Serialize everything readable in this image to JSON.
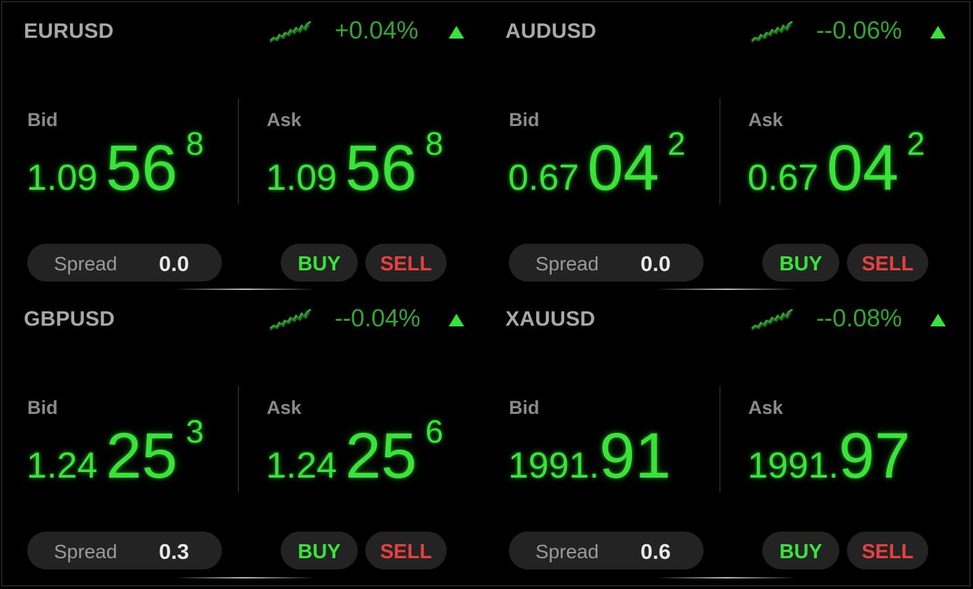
{
  "colors": {
    "background": "#000000",
    "price_green": "#37e437",
    "change_green": "#2ea82e",
    "sell_red": "#e84040",
    "label_gray": "#8a8a8a",
    "pill_bg": "#232323"
  },
  "panels": [
    {
      "symbol": "EURUSD",
      "change": "+0.04%",
      "trend_icon": "sparkline-icon",
      "direction_icon": "triangle-up-icon",
      "bid_label": "Bid",
      "ask_label": "Ask",
      "bid": {
        "prefix": "1.09",
        "big": "56",
        "pip": "8"
      },
      "ask": {
        "prefix": "1.09",
        "big": "56",
        "pip": "8"
      },
      "spread_label": "Spread",
      "spread_value": "0.0",
      "buy_label": "BUY",
      "sell_label": "SELL"
    },
    {
      "symbol": "AUDUSD",
      "change": "--0.06%",
      "trend_icon": "sparkline-icon",
      "direction_icon": "triangle-up-icon",
      "bid_label": "Bid",
      "ask_label": "Ask",
      "bid": {
        "prefix": "0.67",
        "big": "04",
        "pip": "2"
      },
      "ask": {
        "prefix": "0.67",
        "big": "04",
        "pip": "2"
      },
      "spread_label": "Spread",
      "spread_value": "0.0",
      "buy_label": "BUY",
      "sell_label": "SELL"
    },
    {
      "symbol": "GBPUSD",
      "change": "--0.04%",
      "trend_icon": "sparkline-icon",
      "direction_icon": "triangle-up-icon",
      "bid_label": "Bid",
      "ask_label": "Ask",
      "bid": {
        "prefix": "1.24",
        "big": "25",
        "pip": "3"
      },
      "ask": {
        "prefix": "1.24",
        "big": "25",
        "pip": "6"
      },
      "spread_label": "Spread",
      "spread_value": "0.3",
      "buy_label": "BUY",
      "sell_label": "SELL"
    },
    {
      "symbol": "XAUUSD",
      "change": "--0.08%",
      "trend_icon": "sparkline-icon",
      "direction_icon": "triangle-up-icon",
      "bid_label": "Bid",
      "ask_label": "Ask",
      "bid": {
        "prefix": "1991.",
        "big": "91",
        "pip": ""
      },
      "ask": {
        "prefix": "1991.",
        "big": "97",
        "pip": ""
      },
      "spread_label": "Spread",
      "spread_value": "0.6",
      "buy_label": "BUY",
      "sell_label": "SELL"
    }
  ]
}
